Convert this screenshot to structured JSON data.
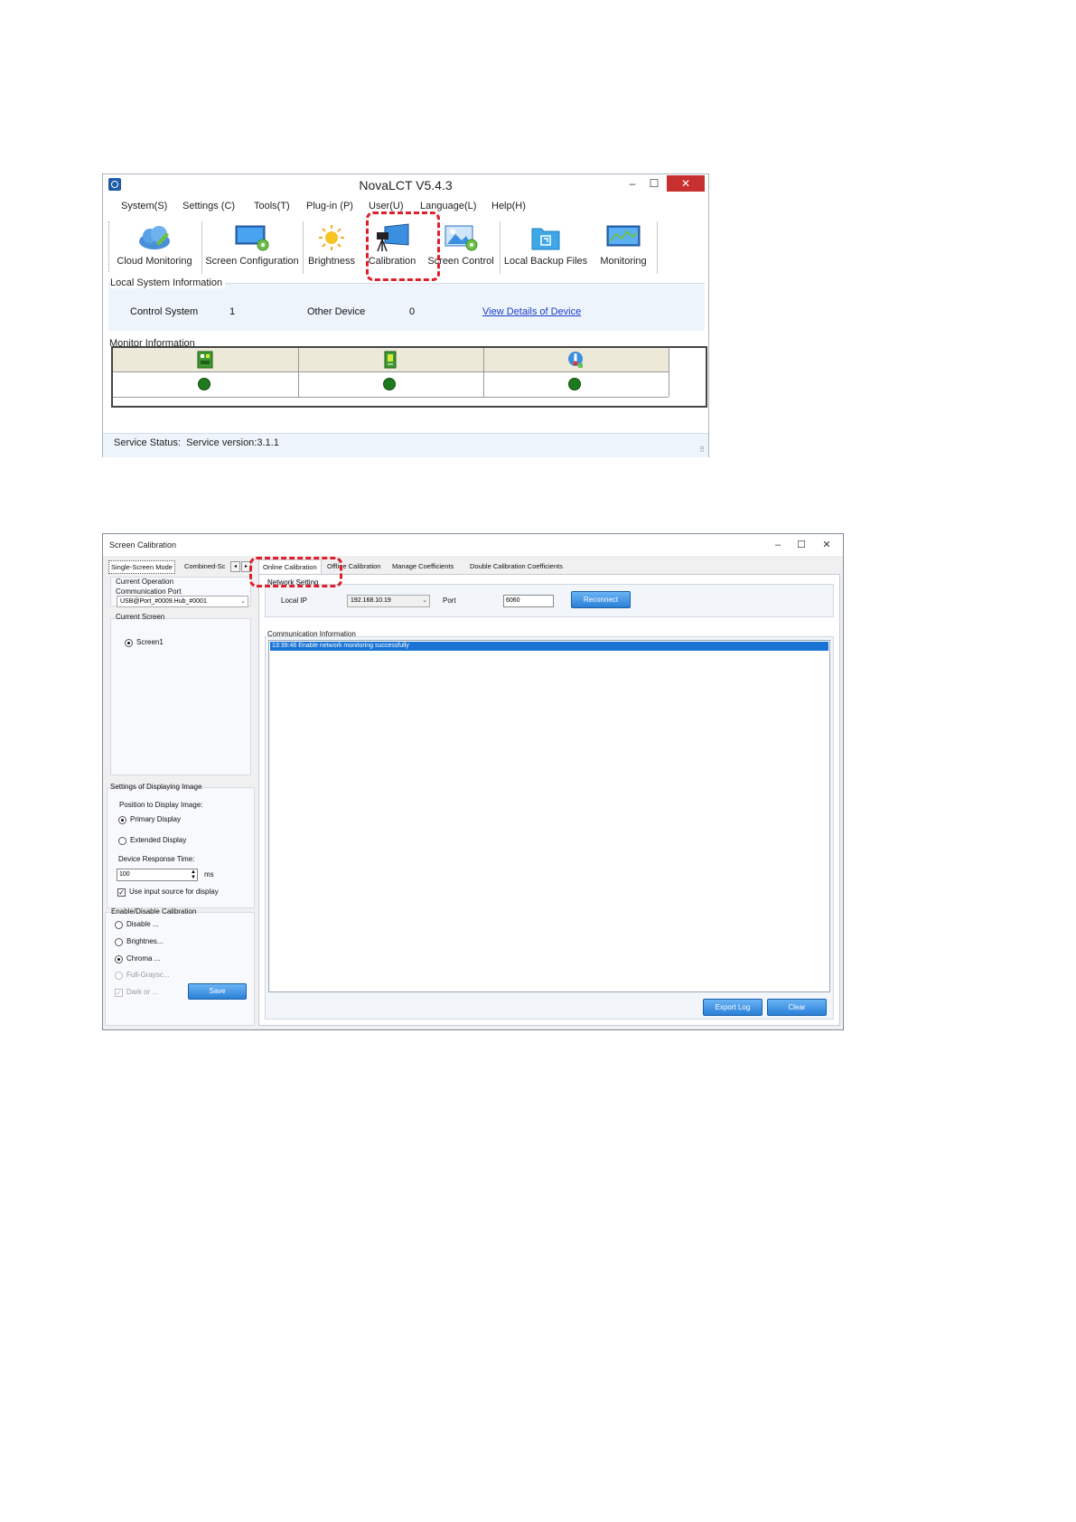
{
  "novalct": {
    "title": "NovaLCT V5.4.3",
    "menu": [
      "System(S)",
      "Settings (C)",
      "Tools(T)",
      "Plug-in (P)",
      "User(U)",
      "Language(L)",
      "Help(H)"
    ],
    "toolbar": [
      {
        "label": "Cloud Monitoring",
        "icon": "cloud-icon"
      },
      {
        "label": "Screen Configuration",
        "icon": "monitor-gear-icon"
      },
      {
        "label": "Brightness",
        "icon": "sun-icon"
      },
      {
        "label": "Calibration",
        "icon": "camera-screen-icon"
      },
      {
        "label": "Screen Control",
        "icon": "picture-gear-icon"
      },
      {
        "label": "Local Backup Files",
        "icon": "folder-icon"
      },
      {
        "label": "Monitoring",
        "icon": "chart-monitor-icon"
      }
    ],
    "local_system": {
      "section_title": "Local System Information",
      "control_system_label": "Control System",
      "control_system_value": "1",
      "other_device_label": "Other Device",
      "other_device_value": "0",
      "view_details_link": "View Details of Device"
    },
    "monitor": {
      "section_title": "Monitor Information",
      "columns": [
        {
          "icon": "sending-card-icon",
          "status_color": "#1f7a1f"
        },
        {
          "icon": "receiving-card-icon",
          "status_color": "#1f7a1f"
        },
        {
          "icon": "temperature-icon",
          "status_color": "#1f7a1f"
        }
      ]
    },
    "status_bar": {
      "label": "Service Status:",
      "version": "Service version:3.1.1"
    },
    "highlight_color": "#e01f2d"
  },
  "calibration": {
    "title": "Screen Calibration",
    "window_buttons": [
      "–",
      "☐",
      "✕"
    ],
    "left_tabs": [
      "Single-Screen Mode",
      "Combined-Sc"
    ],
    "left_arrows": [
      "◂",
      "▸"
    ],
    "current_operation": {
      "title": "Current Operation",
      "comm_port_label": "Communication Port",
      "comm_port_value": "USB@Port_#0009.Hub_#0001"
    },
    "current_screen": {
      "title": "Current Screen",
      "screens": [
        "Screen1"
      ]
    },
    "display_settings": {
      "title": "Settings of Displaying Image",
      "position_label": "Position to Display Image:",
      "primary": "Primary Display",
      "extended": "Extended Display",
      "response_label": "Device Response Time:",
      "response_value": "100",
      "response_unit": "ms",
      "use_input_label": "Use input source for display"
    },
    "enable_disable": {
      "title": "Enable/Disable Calibration",
      "options": [
        "Disable ...",
        "Brightnes...",
        "Chroma ...",
        "Full-Graysc...",
        "Dark or ..."
      ],
      "save_button": "Save"
    },
    "tabs": [
      "Online Calibration",
      "Offline Calibration",
      "Manage Coefficients",
      "Double Calibration Coefficients"
    ],
    "network": {
      "title": "Network Setting",
      "local_ip_label": "Local IP",
      "local_ip_value": "192.168.10.19",
      "port_label": "Port",
      "port_value": "6060",
      "reconnect_button": "Reconnect"
    },
    "communication": {
      "title": "Communication Information",
      "log": [
        "13:39:46  Enable network monitoring successfully"
      ]
    },
    "export_button": "Export Log",
    "clear_button": "Clear",
    "accent_color": "#1a74d6"
  }
}
